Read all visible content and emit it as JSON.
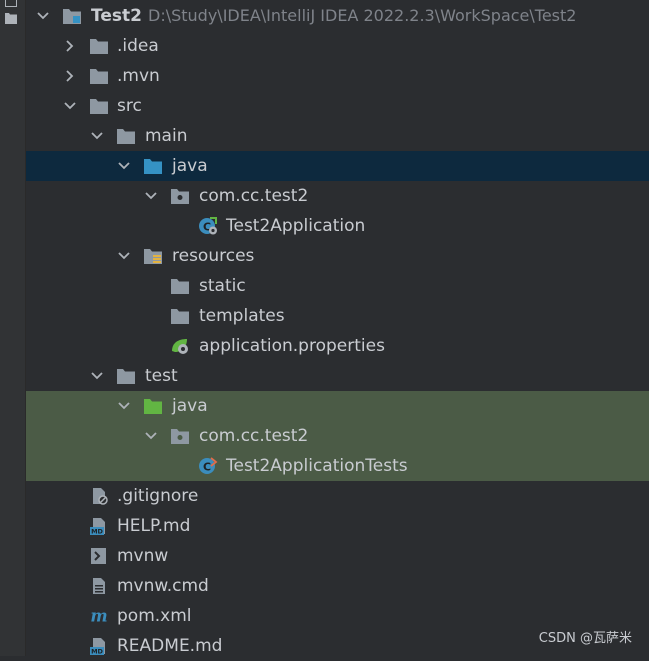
{
  "project": {
    "name": "Test2",
    "path": "D:\\Study\\IDEA\\IntelliJ IDEA 2022.2.3\\WorkSpace\\Test2"
  },
  "tree": [
    {
      "label": ".idea"
    },
    {
      "label": ".mvn"
    },
    {
      "label": "src"
    },
    {
      "label": "main"
    },
    {
      "label": "java"
    },
    {
      "label": "com.cc.test2"
    },
    {
      "label": "Test2Application"
    },
    {
      "label": "resources"
    },
    {
      "label": "static"
    },
    {
      "label": "templates"
    },
    {
      "label": "application.properties"
    },
    {
      "label": "test"
    },
    {
      "label": "java"
    },
    {
      "label": "com.cc.test2"
    },
    {
      "label": "Test2ApplicationTests"
    },
    {
      "label": ".gitignore"
    },
    {
      "label": "HELP.md"
    },
    {
      "label": "mvnw"
    },
    {
      "label": "mvnw.cmd"
    },
    {
      "label": "pom.xml"
    },
    {
      "label": "README.md"
    }
  ],
  "watermark": "CSDN @瓦萨米",
  "colors": {
    "background": "#2b2d30",
    "selected_blue": "#0d293e",
    "selected_green": "#4b5b46",
    "folder": "#8e98a2",
    "source_folder": "#3592c4",
    "test_folder": "#62b543"
  }
}
